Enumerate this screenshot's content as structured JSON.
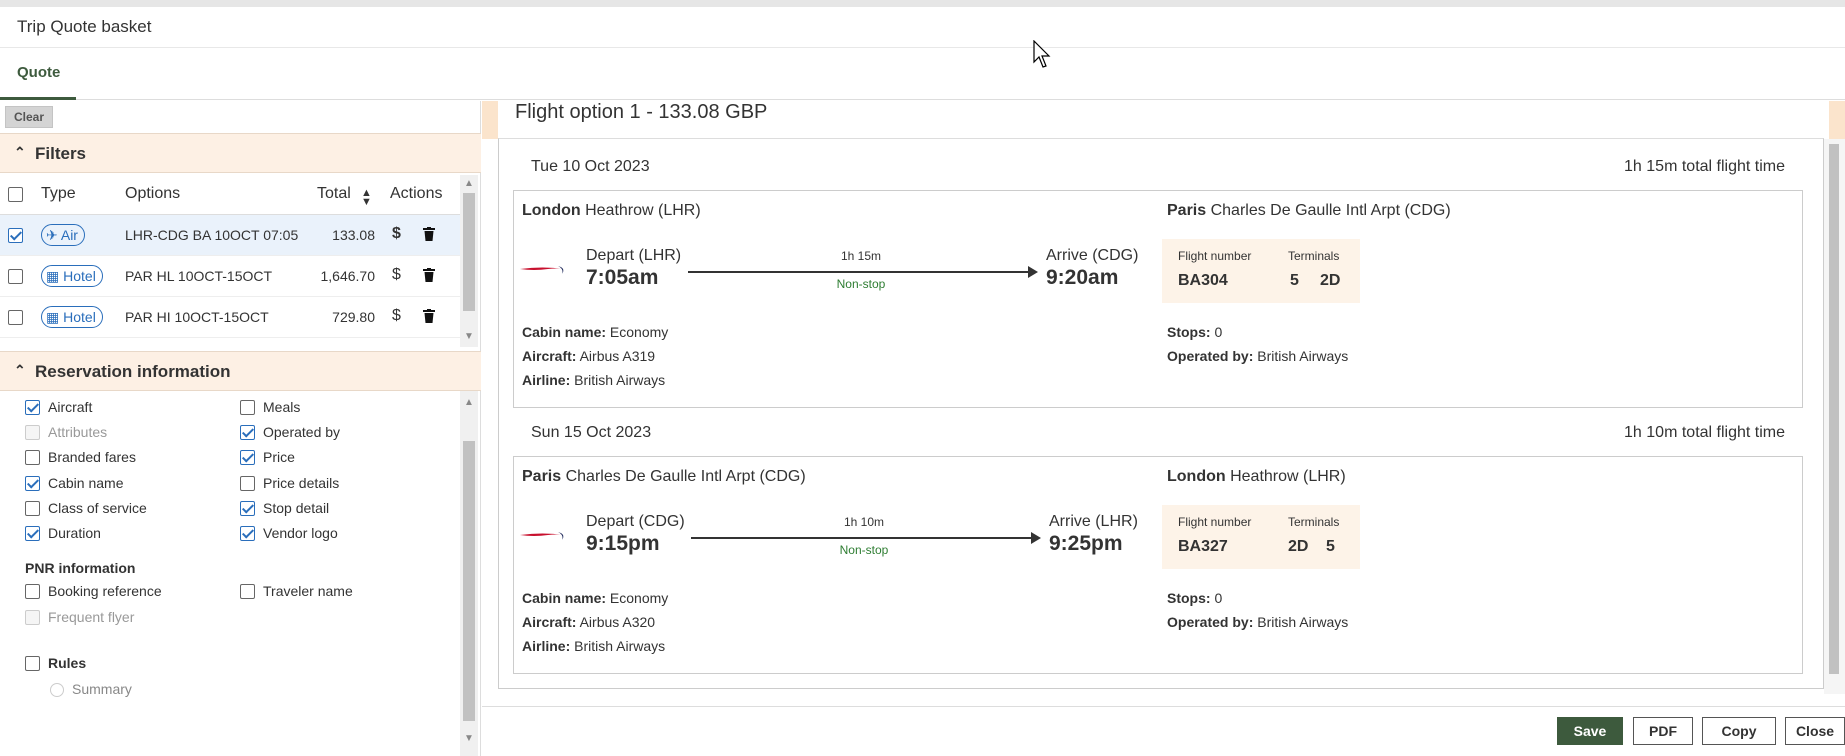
{
  "window": {
    "title": "Trip Quote basket"
  },
  "tabs": [
    {
      "label": "Quote",
      "active": true
    }
  ],
  "left": {
    "clear_label": "Clear",
    "filters_heading": "Filters",
    "columns": {
      "type": "Type",
      "options": "Options",
      "total": "Total",
      "actions": "Actions"
    },
    "rows": [
      {
        "checked": true,
        "type": "Air",
        "type_icon": "airplane-icon",
        "options": "LHR-CDG BA 10OCT 07:05",
        "total": "133.08",
        "dollar_bold": true
      },
      {
        "checked": false,
        "type": "Hotel",
        "type_icon": "building-icon",
        "options": "PAR HL 10OCT-15OCT",
        "total": "1,646.70",
        "dollar_bold": false
      },
      {
        "checked": false,
        "type": "Hotel",
        "type_icon": "building-icon",
        "options": "PAR HI 10OCT-15OCT",
        "total": "729.80",
        "dollar_bold": false
      }
    ],
    "reservation_heading": "Reservation information",
    "reservation_options": {
      "aircraft": {
        "label": "Aircraft",
        "checked": true,
        "disabled": false
      },
      "meals": {
        "label": "Meals",
        "checked": false,
        "disabled": false
      },
      "attributes": {
        "label": "Attributes",
        "checked": false,
        "disabled": true
      },
      "operated_by": {
        "label": "Operated by",
        "checked": true,
        "disabled": false
      },
      "branded_fares": {
        "label": "Branded fares",
        "checked": false,
        "disabled": false
      },
      "price": {
        "label": "Price",
        "checked": true,
        "disabled": false
      },
      "cabin_name": {
        "label": "Cabin name",
        "checked": true,
        "disabled": false
      },
      "price_details": {
        "label": "Price details",
        "checked": false,
        "disabled": false
      },
      "class_of_service": {
        "label": "Class of service",
        "checked": false,
        "disabled": false
      },
      "stop_detail": {
        "label": "Stop detail",
        "checked": true,
        "disabled": false
      },
      "duration": {
        "label": "Duration",
        "checked": true,
        "disabled": false
      },
      "vendor_logo": {
        "label": "Vendor logo",
        "checked": true,
        "disabled": false
      }
    },
    "pnr_heading": "PNR information",
    "pnr_options": {
      "booking_reference": {
        "label": "Booking reference",
        "checked": false
      },
      "traveler_name": {
        "label": "Traveler name",
        "checked": false
      },
      "frequent_flyer": {
        "label": "Frequent flyer",
        "checked": false,
        "disabled": true
      }
    },
    "rules_label": "Rules",
    "rules_checked": false,
    "summary_label": "Summary"
  },
  "main": {
    "option_title": "Flight option 1 - 133.08 GBP",
    "segments": [
      {
        "date": "Tue 10 Oct 2023",
        "total_time": "1h 15m total flight time",
        "origin_city": "London",
        "origin_airport": "Heathrow (LHR)",
        "dest_city": "Paris",
        "dest_airport": "Charles De Gaulle Intl Arpt (CDG)",
        "depart_label": "Depart (LHR)",
        "depart_time": "7:05am",
        "duration": "1h 15m",
        "stops_text": "Non-stop",
        "arrive_label": "Arrive (CDG)",
        "arrive_time": "9:20am",
        "flight_number_label": "Flight number",
        "flight_number": "BA304",
        "terminals_label": "Terminals",
        "terminal_dep": "5",
        "terminal_arr": "2D",
        "cabin_label": "Cabin name:",
        "cabin": "Economy",
        "aircraft_label": "Aircraft:",
        "aircraft": "Airbus A319",
        "airline_label": "Airline:",
        "airline": "British Airways",
        "stops_label": "Stops:",
        "stops": "0",
        "operated_label": "Operated by:",
        "operated": "British Airways"
      },
      {
        "date": "Sun 15 Oct 2023",
        "total_time": "1h 10m total flight time",
        "origin_city": "Paris",
        "origin_airport": "Charles De Gaulle Intl Arpt (CDG)",
        "dest_city": "London",
        "dest_airport": "Heathrow (LHR)",
        "depart_label": "Depart (CDG)",
        "depart_time": "9:15pm",
        "duration": "1h 10m",
        "stops_text": "Non-stop",
        "arrive_label": "Arrive (LHR)",
        "arrive_time": "9:25pm",
        "flight_number_label": "Flight number",
        "flight_number": "BA327",
        "terminals_label": "Terminals",
        "terminal_dep": "2D",
        "terminal_arr": "5",
        "cabin_label": "Cabin name:",
        "cabin": "Economy",
        "aircraft_label": "Aircraft:",
        "aircraft": "Airbus A320",
        "airline_label": "Airline:",
        "airline": "British Airways",
        "stops_label": "Stops:",
        "stops": "0",
        "operated_label": "Operated by:",
        "operated": "British Airways"
      }
    ]
  },
  "footer": {
    "save": "Save",
    "pdf": "PDF",
    "copy": "Copy",
    "close": "Close"
  },
  "colors": {
    "accent_green": "#3d5a3d",
    "link_blue": "#2a6ebb",
    "header_peach": "#fdf0e4",
    "nonstop_green": "#2e7d32",
    "ba_red": "#c8102e",
    "ba_navy": "#1f2a5b"
  }
}
